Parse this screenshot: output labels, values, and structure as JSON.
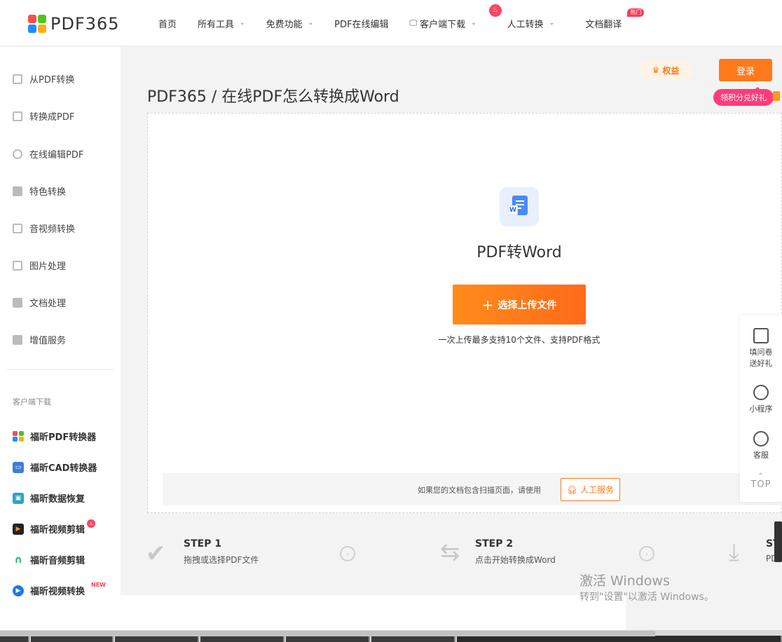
{
  "brand": {
    "name": "PDF365",
    "colors": [
      "#ff4d4f",
      "#52c41a",
      "#1890ff",
      "#faad14"
    ]
  },
  "nav": {
    "items": [
      {
        "label": "首页",
        "has_dropdown": false
      },
      {
        "label": "所有工具",
        "has_dropdown": true
      },
      {
        "label": "免费功能",
        "has_dropdown": true
      },
      {
        "label": "PDF在线编辑",
        "has_dropdown": false
      },
      {
        "label": "客户端下载",
        "has_dropdown": true,
        "icon": "monitor-icon"
      },
      {
        "label": "人工转换",
        "has_dropdown": true,
        "icon": "fire-icon"
      },
      {
        "label": "文档翻译",
        "has_dropdown": false,
        "badge": "热门"
      }
    ]
  },
  "sidebar": {
    "items": [
      {
        "label": "从PDF转换",
        "icon": "from-pdf-icon"
      },
      {
        "label": "转换成PDF",
        "icon": "to-pdf-icon"
      },
      {
        "label": "在线编辑PDF",
        "icon": "edit-pdf-icon"
      },
      {
        "label": "特色转换",
        "icon": "special-convert-icon"
      },
      {
        "label": "音视频转换",
        "icon": "media-convert-icon"
      },
      {
        "label": "图片处理",
        "icon": "image-process-icon"
      },
      {
        "label": "文档处理",
        "icon": "document-process-icon"
      },
      {
        "label": "增值服务",
        "icon": "value-service-icon"
      }
    ],
    "download_section_title": "客户端下载",
    "downloads": [
      {
        "label": "福昕PDF转换器",
        "color": "#4a8af4",
        "icon": "pdf-converter-icon"
      },
      {
        "label": "福昕CAD转换器",
        "color": "#3b7ddd",
        "icon": "cad-converter-icon"
      },
      {
        "label": "福昕数据恢复",
        "color": "#2aa4c8",
        "icon": "data-recovery-icon"
      },
      {
        "label": "福昕视频剪辑",
        "color": "#222222",
        "icon": "video-editor-icon",
        "badge_icon": "fire-icon"
      },
      {
        "label": "福昕音频剪辑",
        "color": "#19b56b",
        "icon": "audio-editor-icon"
      },
      {
        "label": "福昕视频转换",
        "color": "#1f7ae0",
        "icon": "video-converter-icon",
        "badge": "NEW"
      }
    ]
  },
  "account": {
    "perks_label": "权益",
    "login_label": "登录",
    "login_tip": "领积分兑好礼"
  },
  "main": {
    "breadcrumb": "PDF365 / 在线PDF怎么转换成Word",
    "tool_title": "PDF转Word",
    "upload_button": "选择上传文件",
    "upload_hint": "一次上传最多支持10个文件、支持PDF格式",
    "scan_hint": "如果您的文档包含扫描页面，请使用",
    "scan_button": "人工服务"
  },
  "steps": [
    {
      "num": "STEP 1",
      "desc": "拖拽或选择PDF文件",
      "icon": "check-icon"
    },
    {
      "num": "STEP 2",
      "desc": "点击开始转换成Word",
      "icon": "convert-arrows-icon"
    },
    {
      "num": "ST",
      "desc": "PD",
      "icon": "download-icon"
    }
  ],
  "floatbar": {
    "items": [
      {
        "label_line1": "填问卷",
        "label_line2": "送好礼",
        "icon": "survey-icon"
      },
      {
        "label_line1": "小程序",
        "label_line2": "",
        "icon": "mini-program-icon"
      },
      {
        "label_line1": "客服",
        "label_line2": "",
        "icon": "headset-icon"
      },
      {
        "label_line1": "TOP",
        "label_line2": "",
        "icon": "back-to-top-icon"
      }
    ]
  },
  "watermark": {
    "line1": "激活 Windows",
    "line2": "转到\"设置\"以激活 Windows。"
  }
}
